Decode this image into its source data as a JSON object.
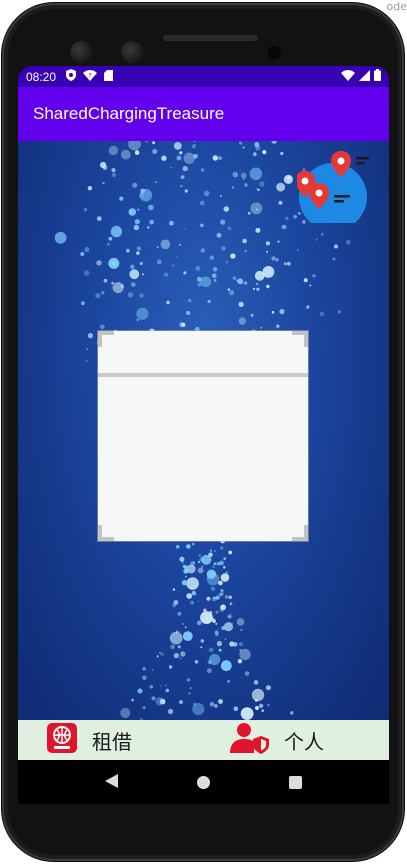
{
  "window": {
    "corner_text": "ode"
  },
  "status_bar": {
    "time": "08:20",
    "left_icons": [
      "shield-icon",
      "wifi-question-icon",
      "sd-card-icon"
    ],
    "right_icons": [
      "wifi-icon",
      "signal-icon",
      "battery-icon"
    ]
  },
  "app_bar": {
    "title": "SharedChargingTreasure"
  },
  "map_button": {
    "icon": "map-pins-icon",
    "pin_color": "#e53935",
    "circle_color": "#1e88e5"
  },
  "scan_box": {
    "background": "#f6f7f9"
  },
  "bottom_nav": {
    "items": [
      {
        "label": "租借",
        "icon": "rent-icon",
        "icon_color": "#e0142b"
      },
      {
        "label": "个人",
        "icon": "user-shield-icon",
        "icon_color": "#e0142b"
      }
    ]
  },
  "system_nav": {
    "buttons": [
      "back-button",
      "home-button",
      "recents-button"
    ]
  },
  "colors": {
    "status_bar": "#3700b3",
    "app_bar": "#6200ee",
    "bottom_nav": "#dff0e0",
    "content_bg": "#1c47a0"
  }
}
